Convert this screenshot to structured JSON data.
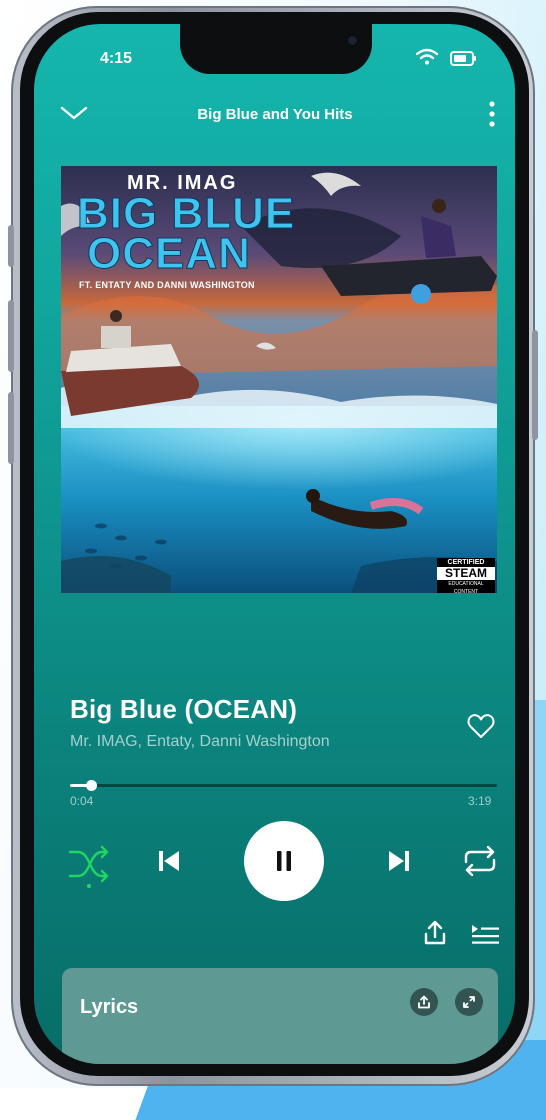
{
  "status_bar": {
    "time": "4:15",
    "icons": [
      "wifi-icon",
      "battery-icon"
    ]
  },
  "header": {
    "title": "Big Blue and You Hits",
    "left_icon": "chevron-down-icon",
    "right_icon": "more-vertical-icon"
  },
  "album_art": {
    "artist": "MR. IMAG",
    "title_line1": "BIG BLUE",
    "title_line2": "OCEAN",
    "subtitle": "FT. ENTATY AND DANNI WASHINGTON",
    "badge_line1": "CERTIFIED",
    "badge_line2": "STEAM",
    "badge_line3": "EDUCATIONAL CONTENT"
  },
  "track": {
    "title": "Big Blue (OCEAN)",
    "artists": "Mr. IMAG, Entaty, Danni Washington",
    "liked": false
  },
  "progress": {
    "elapsed": "0:04",
    "total": "3:19",
    "fraction": 0.05
  },
  "controls": {
    "shuffle_active": true,
    "buttons": [
      "shuffle-icon",
      "previous-icon",
      "pause-icon",
      "next-icon",
      "repeat-icon"
    ]
  },
  "extra_actions": [
    "share-icon",
    "queue-icon"
  ],
  "lyrics": {
    "label": "Lyrics",
    "actions": [
      "share-icon",
      "expand-icon"
    ]
  },
  "colors": {
    "accent": "#1ed760",
    "background_top": "#15b6ad",
    "background_bottom": "#086d68",
    "lyrics_card": "#5e9a93"
  }
}
